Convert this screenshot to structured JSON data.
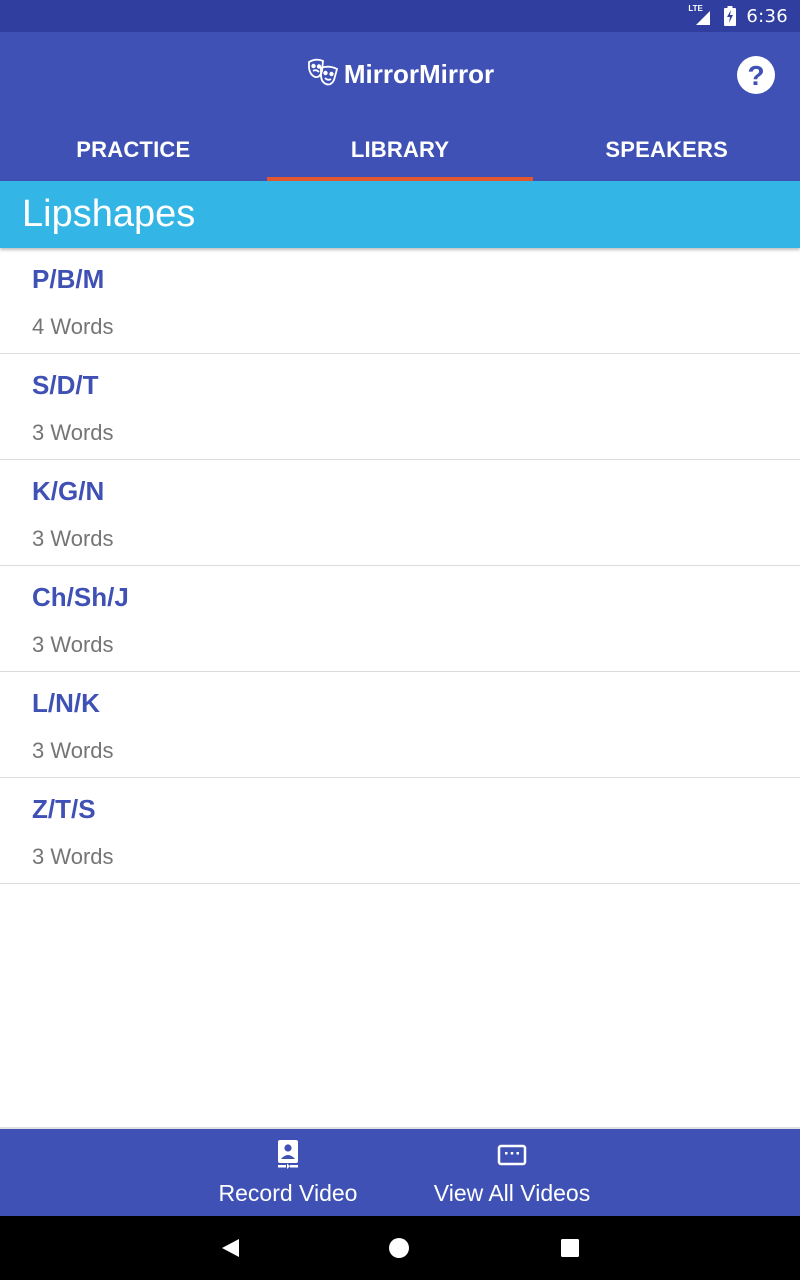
{
  "status_bar": {
    "time": "6:36",
    "network": "LTE"
  },
  "app_bar": {
    "title": "MirrorMirror",
    "logo_icon": "theater-masks-icon",
    "help_icon": "help-icon",
    "help_glyph": "?"
  },
  "tabs": [
    {
      "label": "PRACTICE",
      "active": false
    },
    {
      "label": "LIBRARY",
      "active": true
    },
    {
      "label": "SPEAKERS",
      "active": false
    }
  ],
  "section": {
    "title": "Lipshapes"
  },
  "lipshapes": [
    {
      "title": "P/B/M",
      "count": "4 Words"
    },
    {
      "title": "S/D/T",
      "count": "3 Words"
    },
    {
      "title": "K/G/N",
      "count": "3 Words"
    },
    {
      "title": "Ch/Sh/J",
      "count": "3 Words"
    },
    {
      "title": "L/N/K",
      "count": "3 Words"
    },
    {
      "title": "Z/T/S",
      "count": "3 Words"
    }
  ],
  "bottom_actions": {
    "record": {
      "label": "Record Video",
      "icon": "record-video-icon"
    },
    "view_all": {
      "label": "View All Videos",
      "icon": "video-library-icon"
    }
  },
  "colors": {
    "primary": "#3f51b5",
    "primary_dark": "#303f9f",
    "accent": "#e4572e",
    "section": "#33b5e5"
  }
}
